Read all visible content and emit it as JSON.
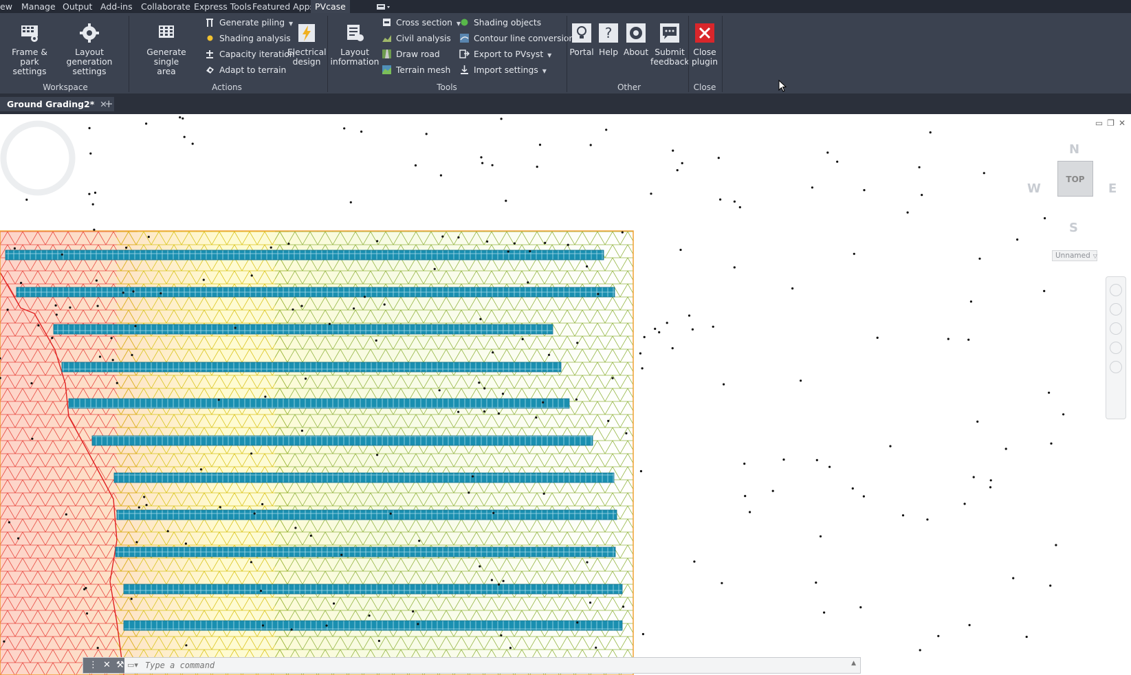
{
  "menu": {
    "items": [
      "ew",
      "Manage",
      "Output",
      "Add-ins",
      "Collaborate",
      "Express Tools",
      "Featured Apps",
      "PVcase"
    ],
    "active": "PVcase"
  },
  "ribbon": {
    "workspace": {
      "label": "Workspace",
      "frame_park_line1": "Frame & park",
      "frame_park_line2": "settings",
      "layout_gen_line1": "Layout generation",
      "layout_gen_line2": "settings"
    },
    "actions": {
      "label": "Actions",
      "gen_single_line1": "Generate single",
      "gen_single_line2": "area",
      "generate_piling": "Generate piling",
      "shading_analysis": "Shading analysis",
      "capacity_iteration": "Capacity iteration",
      "adapt_to_terrain": "Adapt to terrain",
      "electrical_line1": "Electrical",
      "electrical_line2": "design"
    },
    "tools": {
      "label": "Tools",
      "layout_info_line1": "Layout",
      "layout_info_line2": "information",
      "cross_section": "Cross section",
      "civil_analysis": "Civil analysis",
      "draw_road": "Draw road",
      "terrain_mesh": "Terrain mesh",
      "shading_objects": "Shading objects",
      "contour_line_conversion": "Contour line conversion",
      "export_pvsyst": "Export to PVsyst",
      "import_settings": "Import settings"
    },
    "other": {
      "label": "Other",
      "portal": "Portal",
      "help": "Help",
      "about": "About",
      "submit_line1": "Submit",
      "submit_line2": "feedback"
    },
    "close": {
      "label": "Close",
      "close_line1": "Close",
      "close_line2": "plugin"
    }
  },
  "tabs": {
    "document": "Ground Grading2*",
    "close_glyph": "✕",
    "add_glyph": "+"
  },
  "viewcube": {
    "north": "N",
    "south": "S",
    "east": "E",
    "west": "W",
    "top": "TOP",
    "view_name": "Unnamed"
  },
  "command": {
    "placeholder": "Type a command"
  },
  "colors": {
    "ribbon_bg": "#3b4250",
    "menubar_bg": "#252a35",
    "panel_row": "#1a8fb0",
    "boundary": "#f0a030",
    "close_red": "#d9262b"
  },
  "icons": [
    "frame-park-icon",
    "gear-icon",
    "grid-icon",
    "pile-icon",
    "sun-icon",
    "plus-minus-icon",
    "terrain-adapt-icon",
    "lightning-icon",
    "layout-info-icon",
    "cross-section-icon",
    "civil-analysis-icon",
    "road-icon",
    "terrain-mesh-icon",
    "shading-object-icon",
    "contour-icon",
    "export-icon",
    "import-icon",
    "bulb-icon",
    "help-icon",
    "about-icon",
    "feedback-icon",
    "close-icon",
    "cursor-icon"
  ]
}
